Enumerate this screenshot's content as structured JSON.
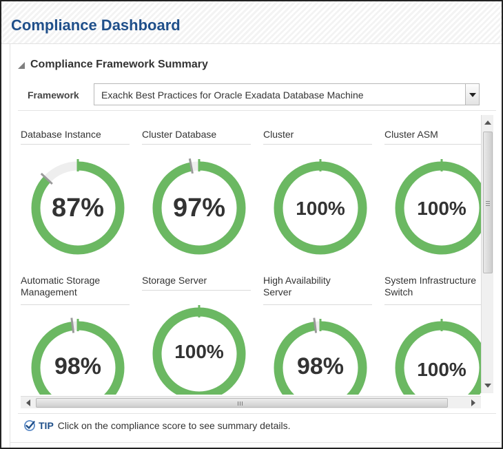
{
  "header": {
    "title": "Compliance Dashboard"
  },
  "section": {
    "title": "Compliance Framework Summary"
  },
  "framework": {
    "label": "Framework",
    "selected": "Exachk Best Practices for Oracle Exadata Database Machine"
  },
  "colors": {
    "ring_fill": "#6bb862",
    "ring_track": "#eeeeee",
    "title_blue": "#1f4f8a"
  },
  "tiles": [
    {
      "label": "Database Instance",
      "value": "87%",
      "percent": 87
    },
    {
      "label": "Cluster Database",
      "value": "97%",
      "percent": 97
    },
    {
      "label": "Cluster",
      "value": "100%",
      "percent": 100
    },
    {
      "label": "Cluster ASM",
      "value": "100%",
      "percent": 100
    },
    {
      "label": "Automatic Storage Management",
      "value": "98%",
      "percent": 98
    },
    {
      "label": "Storage Server",
      "value": "100%",
      "percent": 100
    },
    {
      "label": "High Availability Server",
      "value": "98%",
      "percent": 98
    },
    {
      "label": "System Infrastructure Switch",
      "value": "100%",
      "percent": 100
    }
  ],
  "tip": {
    "label": "TIP",
    "text": "Click on the compliance score to see summary details."
  },
  "scrollbar": {
    "h_grip": "III",
    "v_grip": "≡"
  }
}
